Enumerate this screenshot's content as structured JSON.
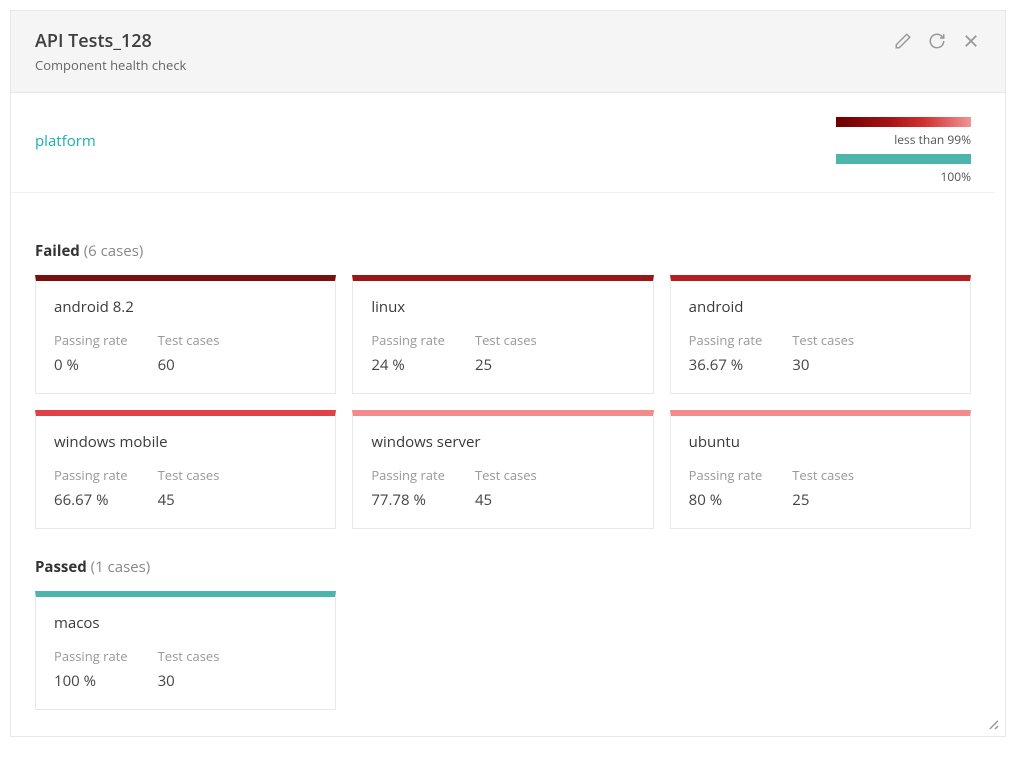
{
  "header": {
    "title": "API Tests_128",
    "subtitle": "Component health check"
  },
  "groupLabel": "platform",
  "legend": {
    "lessThan": "less than 99%",
    "full": "100%"
  },
  "labels": {
    "passingRate": "Passing rate",
    "testCases": "Test cases"
  },
  "sections": [
    {
      "title": "Failed",
      "count": "(6 cases)",
      "cards": [
        {
          "name": "android 8.2",
          "rate": "0 %",
          "cases": "60",
          "color": "#7a0f0f"
        },
        {
          "name": "linux",
          "rate": "24 %",
          "cases": "25",
          "color": "#9a1717"
        },
        {
          "name": "android",
          "rate": "36.67 %",
          "cases": "30",
          "color": "#b51f1f"
        },
        {
          "name": "windows mobile",
          "rate": "66.67 %",
          "cases": "45",
          "color": "#df404a"
        },
        {
          "name": "windows server",
          "rate": "77.78 %",
          "cases": "45",
          "color": "#f28b8b"
        },
        {
          "name": "ubuntu",
          "rate": "80 %",
          "cases": "25",
          "color": "#f28b8b"
        }
      ]
    },
    {
      "title": "Passed",
      "count": "(1 cases)",
      "cards": [
        {
          "name": "macos",
          "rate": "100 %",
          "cases": "30",
          "color": "#4db6ac"
        }
      ]
    }
  ]
}
